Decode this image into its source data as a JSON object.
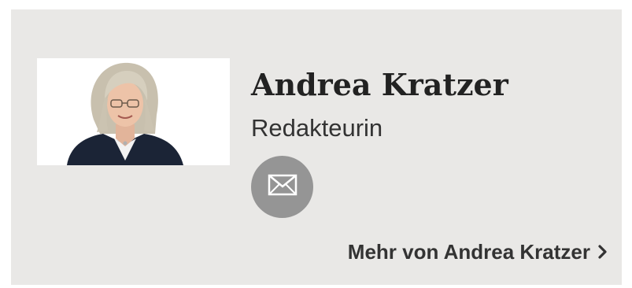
{
  "author": {
    "name": "Andrea Kratzer",
    "role": "Redakteurin",
    "more_link": "Mehr von Andrea Kratzer"
  },
  "icons": {
    "mail": "envelope-icon",
    "more": "chevron-right-icon"
  },
  "colors": {
    "card_background": "#e9e8e6",
    "mail_button": "#959595",
    "text": "#222222"
  }
}
